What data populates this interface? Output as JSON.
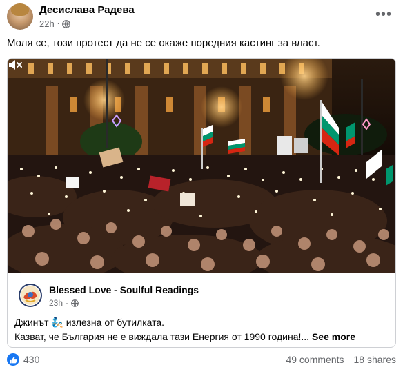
{
  "post": {
    "author": "Десислава Радева",
    "time": "22h",
    "privacy_icon": "globe-icon",
    "menu_icon": "more-options-icon",
    "caption": "Моля се, този протест да не се окаже поредния кастинг за власт."
  },
  "shared": {
    "video": {
      "content": "night protest crowd with phone lights and Bulgarian flags",
      "mute_icon": "muted-speaker-icon"
    },
    "page_name": "Blessed Love - Soulful Readings",
    "time": "23h",
    "privacy_icon": "globe-icon",
    "line1_a": "Джинът ",
    "emoji": "🧞",
    "line1_b": " излезна от бутилката.",
    "line2": "Казват, че България не е виждала тази Енергия от 1990 година!...",
    "see_more": "See more"
  },
  "footer": {
    "reaction_icon": "like-icon",
    "reactions_count": "430",
    "comments": "49 comments",
    "shares": "18 shares"
  },
  "colors": {
    "accent": "#1877f2",
    "secondary_text": "#65676b",
    "border": "#ced0d4"
  }
}
